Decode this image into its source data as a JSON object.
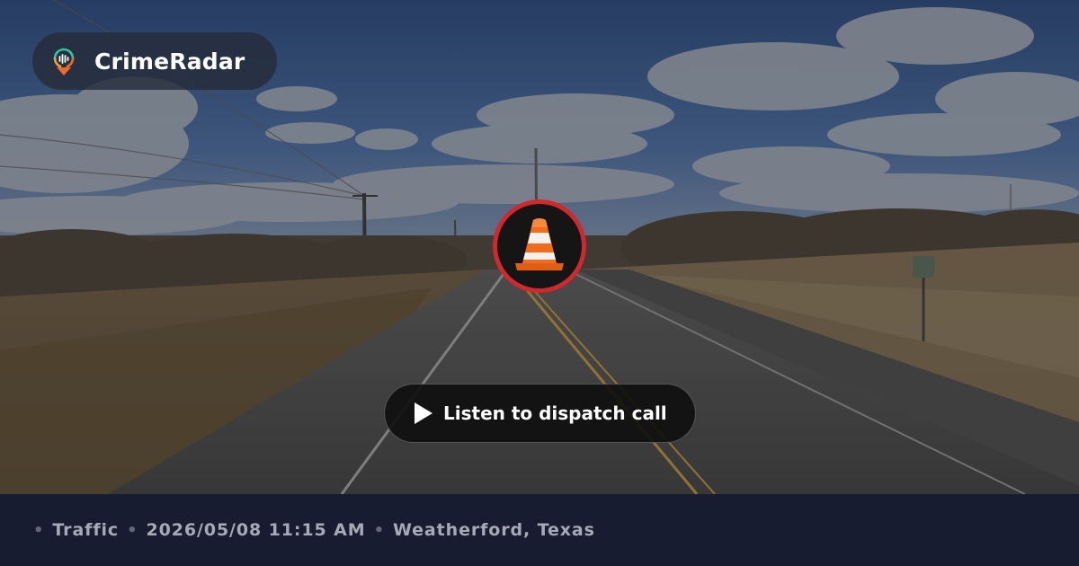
{
  "brand": {
    "name": "CrimeRadar",
    "logo_icon": "radar-pin-icon"
  },
  "incident": {
    "category_icon": "traffic-cone-icon",
    "category": "Traffic",
    "datetime": "2026/05/08 11:15 AM",
    "location": "Weatherford, Texas"
  },
  "listen_button": {
    "label": "Listen to dispatch call",
    "icon": "play-icon"
  },
  "footer": {
    "separator": "•"
  },
  "colors": {
    "badge_ring": "#d0282b",
    "cone_orange": "#f26a1b",
    "footer_bg": "#171c30",
    "footer_text": "#a6aab7"
  }
}
